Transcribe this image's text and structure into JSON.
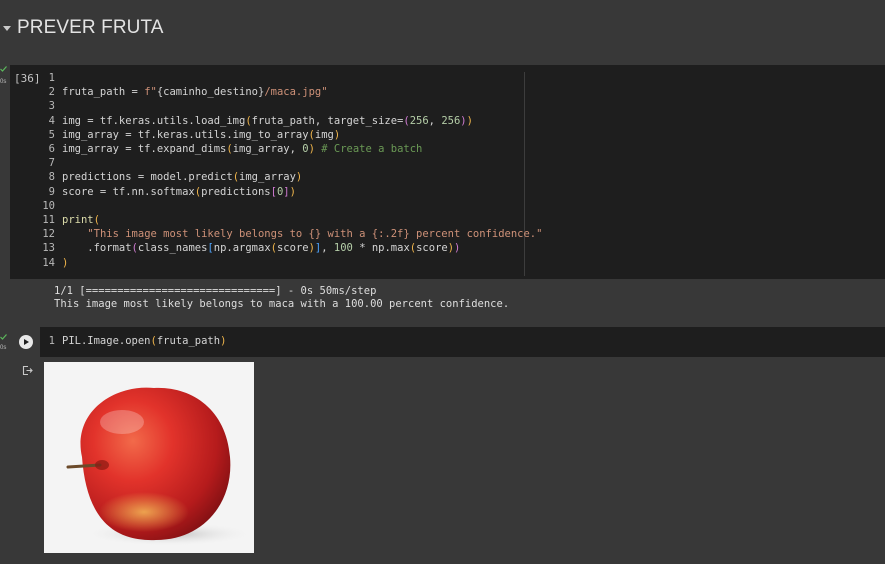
{
  "section": {
    "title": "PREVER FRUTA"
  },
  "cell1": {
    "exec_count": "[36]",
    "status_time": "0s",
    "lines": [
      {
        "n": "1",
        "segs": []
      },
      {
        "n": "2",
        "segs": [
          {
            "t": "fruta_path = "
          },
          {
            "t": "f\"",
            "c": "str"
          },
          {
            "t": "{caminho_destino}"
          },
          {
            "t": "/maca.jpg\"",
            "c": "str"
          }
        ]
      },
      {
        "n": "3",
        "segs": []
      },
      {
        "n": "4",
        "segs": [
          {
            "t": "img = tf.keras.utils.load_img"
          },
          {
            "t": "(",
            "c": "br"
          },
          {
            "t": "fruta_path, target_size="
          },
          {
            "t": "(",
            "c": "br2"
          },
          {
            "t": "256",
            "c": "num"
          },
          {
            "t": ", "
          },
          {
            "t": "256",
            "c": "num"
          },
          {
            "t": ")",
            "c": "br2"
          },
          {
            "t": ")",
            "c": "br"
          }
        ]
      },
      {
        "n": "5",
        "segs": [
          {
            "t": "img_array = tf.keras.utils.img_to_array"
          },
          {
            "t": "(",
            "c": "br"
          },
          {
            "t": "img"
          },
          {
            "t": ")",
            "c": "br"
          }
        ]
      },
      {
        "n": "6",
        "segs": [
          {
            "t": "img_array = tf.expand_dims"
          },
          {
            "t": "(",
            "c": "br"
          },
          {
            "t": "img_array, "
          },
          {
            "t": "0",
            "c": "num"
          },
          {
            "t": ")",
            "c": "br"
          },
          {
            "t": " # Create a batch",
            "c": "com"
          }
        ]
      },
      {
        "n": "7",
        "segs": []
      },
      {
        "n": "8",
        "segs": [
          {
            "t": "predictions = model.predict"
          },
          {
            "t": "(",
            "c": "br"
          },
          {
            "t": "img_array"
          },
          {
            "t": ")",
            "c": "br"
          }
        ]
      },
      {
        "n": "9",
        "segs": [
          {
            "t": "score = tf.nn.softmax"
          },
          {
            "t": "(",
            "c": "br"
          },
          {
            "t": "predictions"
          },
          {
            "t": "[",
            "c": "br2"
          },
          {
            "t": "0",
            "c": "num"
          },
          {
            "t": "]",
            "c": "br2"
          },
          {
            "t": ")",
            "c": "br"
          }
        ]
      },
      {
        "n": "10",
        "segs": []
      },
      {
        "n": "11",
        "segs": [
          {
            "t": "print",
            "c": "fn"
          },
          {
            "t": "(",
            "c": "br"
          }
        ]
      },
      {
        "n": "12",
        "segs": [
          {
            "t": "    "
          },
          {
            "t": "\"This image most likely belongs to {} with a {:.2f} percent confidence.\"",
            "c": "str"
          }
        ]
      },
      {
        "n": "13",
        "segs": [
          {
            "t": "    .format"
          },
          {
            "t": "(",
            "c": "br2"
          },
          {
            "t": "class_names"
          },
          {
            "t": "[",
            "c": "br3"
          },
          {
            "t": "np.argmax"
          },
          {
            "t": "(",
            "c": "br"
          },
          {
            "t": "score"
          },
          {
            "t": ")",
            "c": "br"
          },
          {
            "t": "]",
            "c": "br3"
          },
          {
            "t": ", "
          },
          {
            "t": "100",
            "c": "num"
          },
          {
            "t": " * np.max"
          },
          {
            "t": "(",
            "c": "br"
          },
          {
            "t": "score"
          },
          {
            "t": ")",
            "c": "br"
          },
          {
            "t": ")",
            "c": "br2"
          }
        ]
      },
      {
        "n": "14",
        "segs": [
          {
            "t": ")",
            "c": "br"
          }
        ]
      }
    ],
    "output_lines": [
      "1/1 [==============================] - 0s 50ms/step",
      "This image most likely belongs to maca with a 100.00 percent confidence."
    ]
  },
  "cell2": {
    "status_time": "0s",
    "lines": [
      {
        "n": "1",
        "segs": [
          {
            "t": "PIL.Image.open"
          },
          {
            "t": "(",
            "c": "br"
          },
          {
            "t": "fruta_path"
          },
          {
            "t": ")",
            "c": "br"
          }
        ]
      }
    ],
    "output_image": "red-apple-photo"
  },
  "colors": {
    "background": "#383838",
    "editor": "#1e1e1e",
    "string": "#ce9178",
    "number": "#b5cea8",
    "comment": "#6a9955"
  }
}
